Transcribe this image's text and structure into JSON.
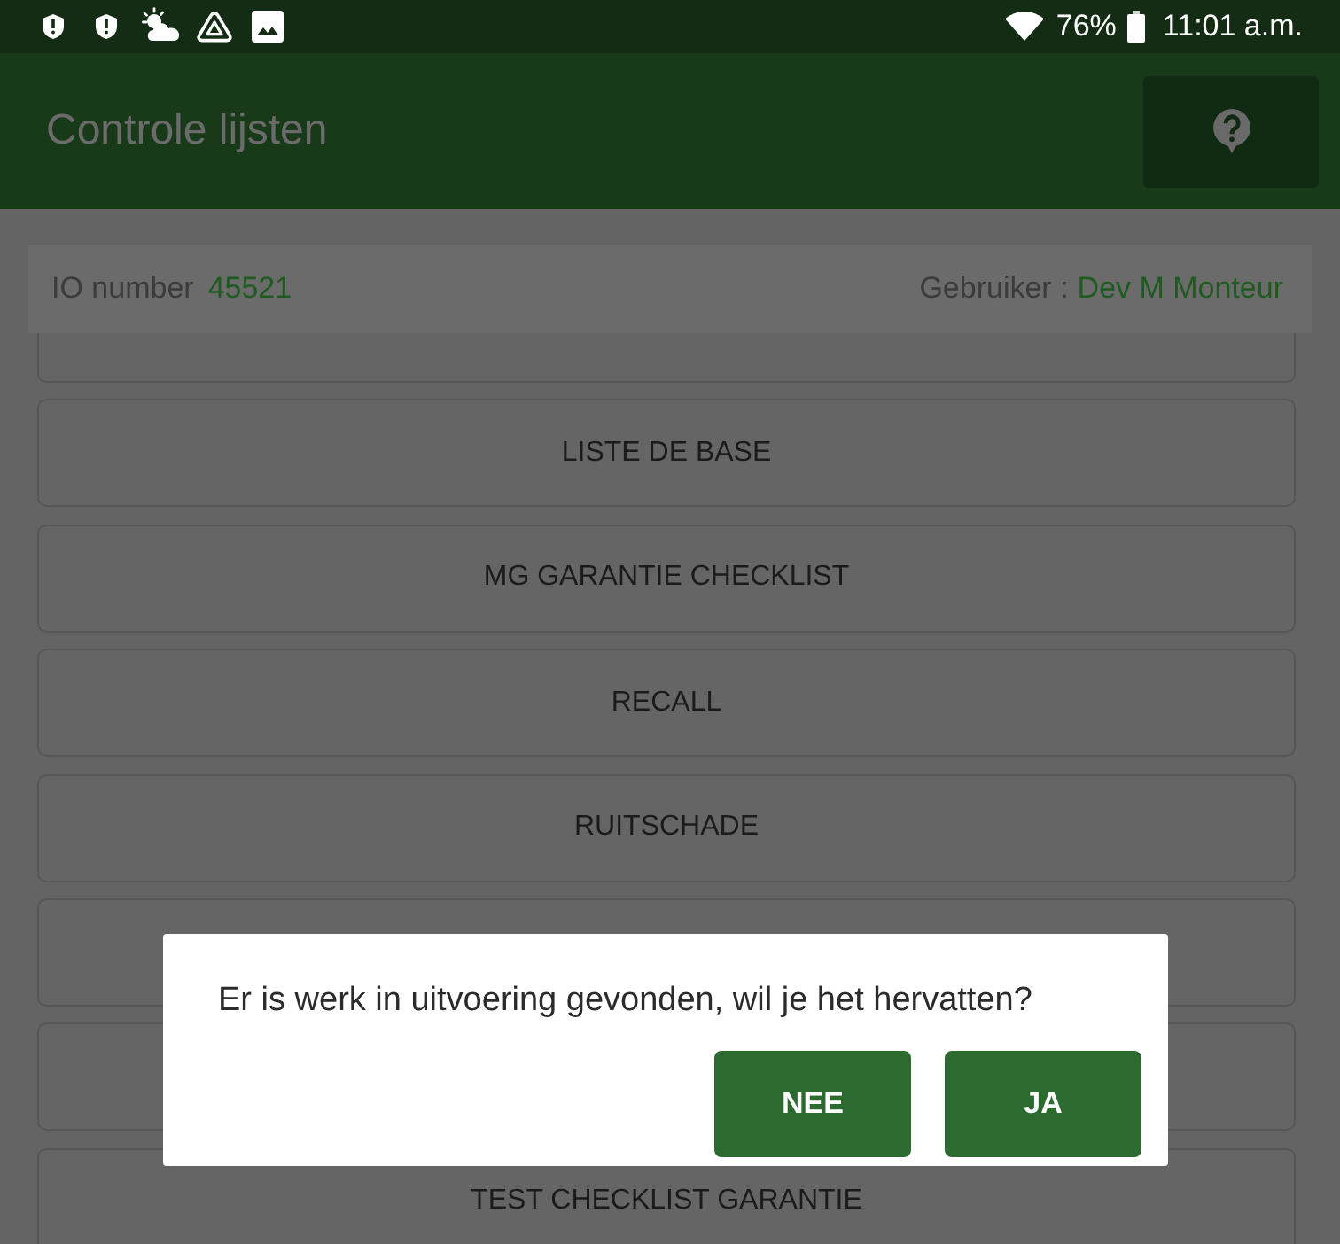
{
  "status_bar": {
    "battery": "76%",
    "time": "11:01 a.m."
  },
  "app_bar": {
    "title": "Controle lijsten"
  },
  "info_bar": {
    "io_label": "IO number",
    "io_value": "45521",
    "user_label": "Gebruiker :",
    "user_value": "Dev M Monteur"
  },
  "checklists": [
    {
      "kind": "partial"
    },
    {
      "kind": "item",
      "label": "LISTE DE BASE"
    },
    {
      "kind": "item",
      "label": "MG GARANTIE CHECKLIST"
    },
    {
      "kind": "item",
      "label": "RECALL"
    },
    {
      "kind": "item",
      "label": "RUITSCHADE"
    },
    {
      "kind": "covered"
    },
    {
      "kind": "covered"
    },
    {
      "kind": "item",
      "label": "TEST CHECKLIST GARANTIE"
    }
  ],
  "dialog": {
    "message": "Er is werk in uitvoering gevonden, wil je het hervatten?",
    "buttons": [
      "NEE",
      "JA"
    ]
  }
}
